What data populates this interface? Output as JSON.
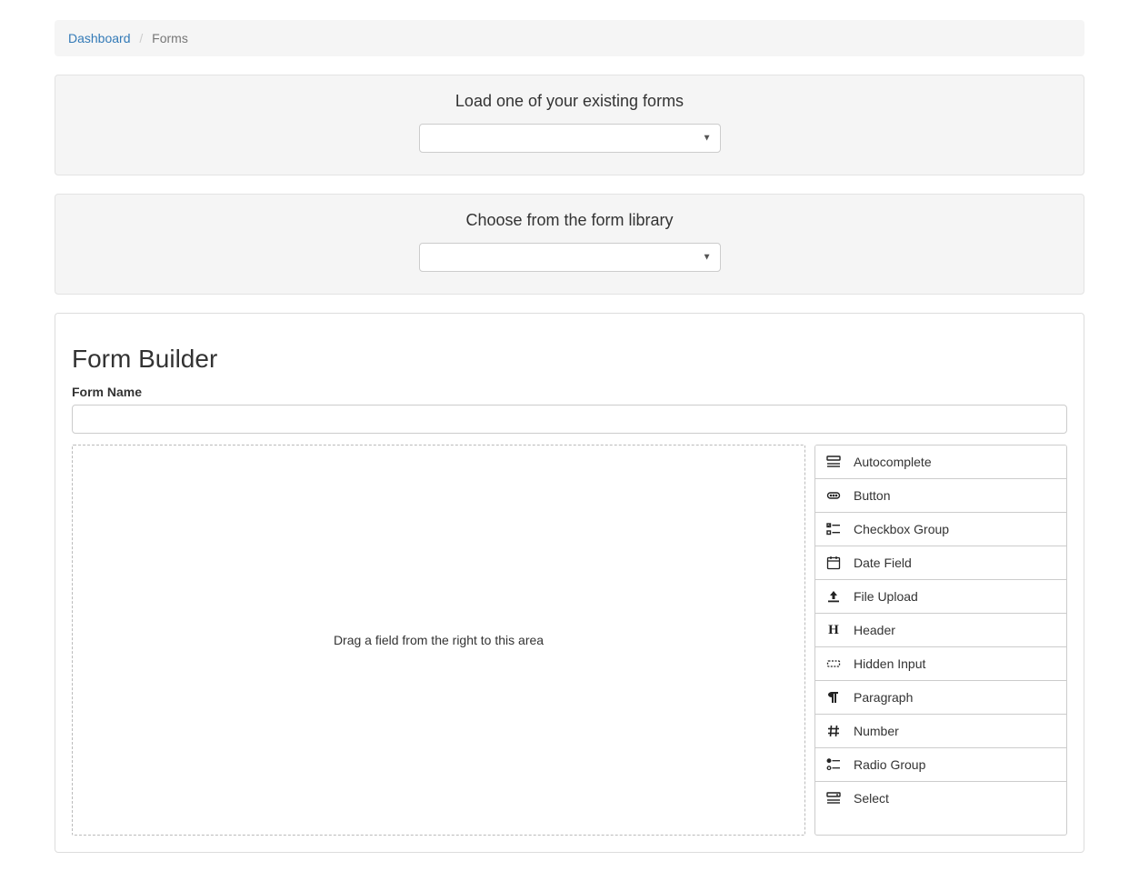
{
  "breadcrumb": {
    "dashboard": "Dashboard",
    "current": "Forms"
  },
  "load_existing": {
    "title": "Load one of your existing forms",
    "selected": ""
  },
  "library": {
    "title": "Choose from the form library",
    "selected": ""
  },
  "builder": {
    "heading": "Form Builder",
    "form_name_label": "Form Name",
    "form_name_value": "",
    "drop_hint": "Drag a field from the right to this area"
  },
  "palette": [
    {
      "icon": "autocomplete",
      "label": "Autocomplete"
    },
    {
      "icon": "button",
      "label": "Button"
    },
    {
      "icon": "checkbox-group",
      "label": "Checkbox Group"
    },
    {
      "icon": "date",
      "label": "Date Field"
    },
    {
      "icon": "upload",
      "label": "File Upload"
    },
    {
      "icon": "header",
      "label": "Header"
    },
    {
      "icon": "hidden",
      "label": "Hidden Input"
    },
    {
      "icon": "paragraph",
      "label": "Paragraph"
    },
    {
      "icon": "number",
      "label": "Number"
    },
    {
      "icon": "radio-group",
      "label": "Radio Group"
    },
    {
      "icon": "select",
      "label": "Select"
    }
  ]
}
